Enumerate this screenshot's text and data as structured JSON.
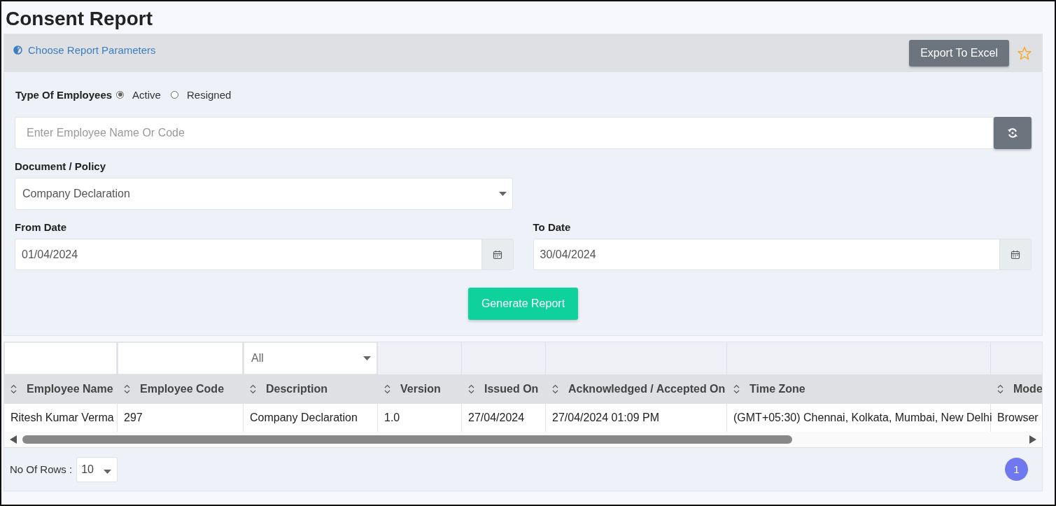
{
  "title": "Consent Report",
  "params": {
    "toggle_label": "Choose Report Parameters",
    "export_button": "Export To Excel",
    "favorite": false,
    "employee_type": {
      "label": "Type Of Employees",
      "options": [
        {
          "label": "Active",
          "selected": true
        },
        {
          "label": "Resigned",
          "selected": false
        }
      ]
    },
    "employee_search": {
      "placeholder": "Enter Employee Name Or Code"
    },
    "document": {
      "label": "Document / Policy",
      "value": "Company Declaration"
    },
    "from_date": {
      "label": "From Date",
      "value": "01/04/2024"
    },
    "to_date": {
      "label": "To Date",
      "value": "30/04/2024"
    },
    "generate_button": "Generate Report"
  },
  "table": {
    "filters": [
      {
        "kind": "text"
      },
      {
        "kind": "text"
      },
      {
        "kind": "select",
        "value": "All"
      },
      {
        "kind": "blank"
      },
      {
        "kind": "blank"
      },
      {
        "kind": "blank"
      },
      {
        "kind": "blank"
      },
      {
        "kind": "blank"
      }
    ],
    "columns": [
      "Employee Name",
      "Employee Code",
      "Description",
      "Version",
      "Issued On",
      "Acknowledged / Accepted On",
      "Time Zone",
      "Mode"
    ],
    "rows": [
      [
        "Ritesh Kumar Verma",
        "297",
        "Company Declaration",
        "1.0",
        "27/04/2024",
        "27/04/2024 01:09 PM",
        "(GMT+05:30) Chennai, Kolkata, Mumbai, New Delhi",
        "Browser"
      ]
    ]
  },
  "footer": {
    "rows_label": "No Of Rows :",
    "rows_value": "10",
    "pages": [
      {
        "label": "1",
        "selected": true
      }
    ]
  }
}
